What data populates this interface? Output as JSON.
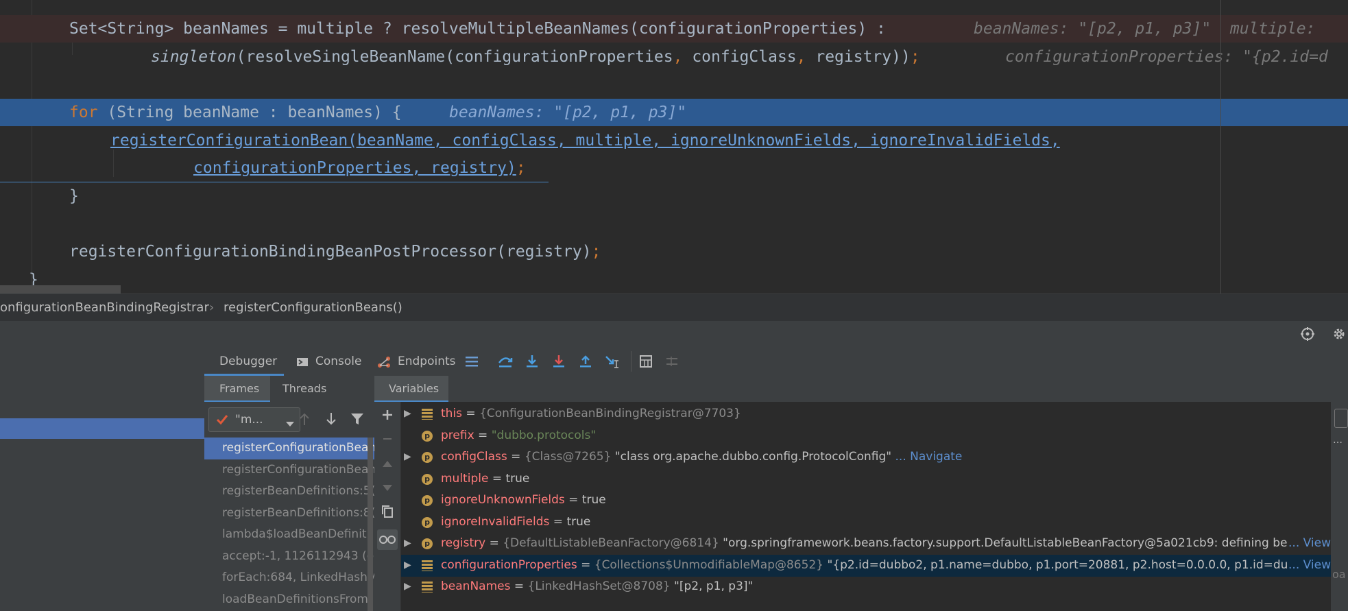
{
  "code": {
    "line1": {
      "pre": "Set<String> beanNames = multiple ? resolveMultipleBeanNames(configurationProperties) :",
      "hint": "beanNames: \"[p2, p1, p3]\"  multiple: "
    },
    "line2": {
      "fn": "singleton",
      "args_a": "(resolveSingleBeanName(configurationProperties",
      "comma1": ",",
      "args_b": " configClass",
      "comma2": ",",
      "args_c": " registry))",
      "semi": ";",
      "hint": "configurationProperties: \"{p2.id=d"
    },
    "line3": {
      "kw": "for",
      "rest": " (String beanName : beanNames) {",
      "hint": "beanNames: \"[p2, p1, p3]\""
    },
    "line4": {
      "call": "registerConfigurationBean(beanName, configClass, multiple, ignoreUnknownFields, ignoreInvalidFields,"
    },
    "line5": {
      "call": "configurationProperties, registry)",
      "semi": ";"
    },
    "line6": {
      "text": "}"
    },
    "line7": {
      "call": "registerConfigurationBindingBeanPostProcessor(registry)",
      "semi": ";"
    },
    "line8": {
      "text": "}"
    }
  },
  "breadcrumb": {
    "class": "onfigurationBeanBindingRegistrar",
    "sep": "›",
    "method": "registerConfigurationBeans()"
  },
  "debugger": {
    "tabs": [
      "Debugger",
      "Console",
      "Endpoints"
    ],
    "subtabs": {
      "frames": "Frames",
      "threads": "Threads",
      "variables": "Variables"
    },
    "thread_select": "\"m...",
    "frames": [
      "registerConfigurationBean",
      "registerConfigurationBean",
      "registerBeanDefinitions:5(",
      "registerBeanDefinitions:8(",
      "lambda$loadBeanDefiniti",
      "accept:-1, 1126112943 (o",
      "forEach:684, LinkedHashM",
      "loadBeanDefinitionsFromI"
    ],
    "variables": [
      {
        "name": "this",
        "eq": " = ",
        "type": "{ConfigurationBeanBindingRegistrar@7703}",
        "value": "",
        "nav": "",
        "kind": "f",
        "expand": true
      },
      {
        "name": "prefix",
        "eq": " = ",
        "type": "",
        "value": "\"dubbo.protocols\"",
        "nav": "",
        "kind": "p",
        "expand": false,
        "str": true
      },
      {
        "name": "configClass",
        "eq": " = ",
        "type": "{Class@7265}",
        "value": " \"class org.apache.dubbo.config.ProtocolConfig\"",
        "nav": " ... Navigate",
        "kind": "p",
        "expand": true
      },
      {
        "name": "multiple",
        "eq": " = ",
        "type": "",
        "value": "true",
        "nav": "",
        "kind": "p",
        "expand": false
      },
      {
        "name": "ignoreUnknownFields",
        "eq": " = ",
        "type": "",
        "value": "true",
        "nav": "",
        "kind": "p",
        "expand": false
      },
      {
        "name": "ignoreInvalidFields",
        "eq": " = ",
        "type": "",
        "value": "true",
        "nav": "",
        "kind": "p",
        "expand": false
      },
      {
        "name": "registry",
        "eq": " = ",
        "type": "{DefaultListableBeanFactory@6814}",
        "value": " \"org.springframework.beans.factory.support.DefaultListableBeanFactory@5a021cb9: defining be",
        "nav": "... View",
        "kind": "p",
        "expand": true
      },
      {
        "name": "configurationProperties",
        "eq": " = ",
        "type": "{Collections$UnmodifiableMap@8652}",
        "value": " \"{p2.id=dubbo2, p1.name=dubbo, p1.port=20881, p2.host=0.0.0.0, p1.id=du",
        "nav": "... View",
        "kind": "f",
        "expand": true,
        "selected": true
      },
      {
        "name": "beanNames",
        "eq": " = ",
        "type": "{LinkedHashSet@8708}",
        "value": " \"[p2, p1, p3]\"",
        "nav": "",
        "kind": "f",
        "expand": true
      }
    ],
    "right_label": "oa"
  }
}
